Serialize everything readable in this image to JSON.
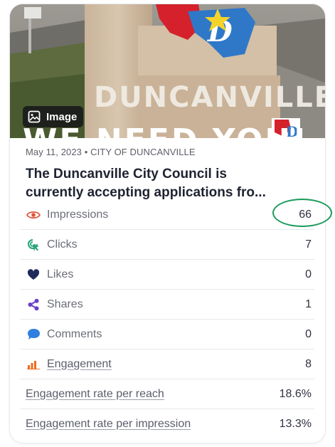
{
  "post": {
    "image_badge": "Image",
    "hero_text": {
      "sign": "DUNCANVILLE",
      "banner": "WE NEED YOU!"
    },
    "meta": "May 11, 2023 • CITY OF DUNCANVILLE",
    "title_line1": "The Duncanville City Council is",
    "title_line2": "currently accepting applications fro..."
  },
  "metrics": [
    {
      "label": "Impressions",
      "value": "66",
      "icon": "eye-icon",
      "color": "#e0553a"
    },
    {
      "label": "Clicks",
      "value": "7",
      "icon": "click-cursor-icon",
      "color": "#27a47a"
    },
    {
      "label": "Likes",
      "value": "0",
      "icon": "heart-icon",
      "color": "#1e2a5a"
    },
    {
      "label": "Shares",
      "value": "1",
      "icon": "share-icon",
      "color": "#6a3fc9"
    },
    {
      "label": "Comments",
      "value": "0",
      "icon": "comment-icon",
      "color": "#2f7fe0"
    },
    {
      "label": "Engagement",
      "value": "8",
      "icon": "bar-chart-icon",
      "color": "#ef6a1a"
    }
  ],
  "rates": [
    {
      "label": "Engagement rate per reach",
      "value": "18.6%"
    },
    {
      "label": "Engagement rate per impression",
      "value": "13.3%"
    }
  ],
  "colors": {
    "highlight_ring": "#1a9a5a",
    "text_primary": "#1f2230",
    "text_secondary": "#6b6e78"
  }
}
